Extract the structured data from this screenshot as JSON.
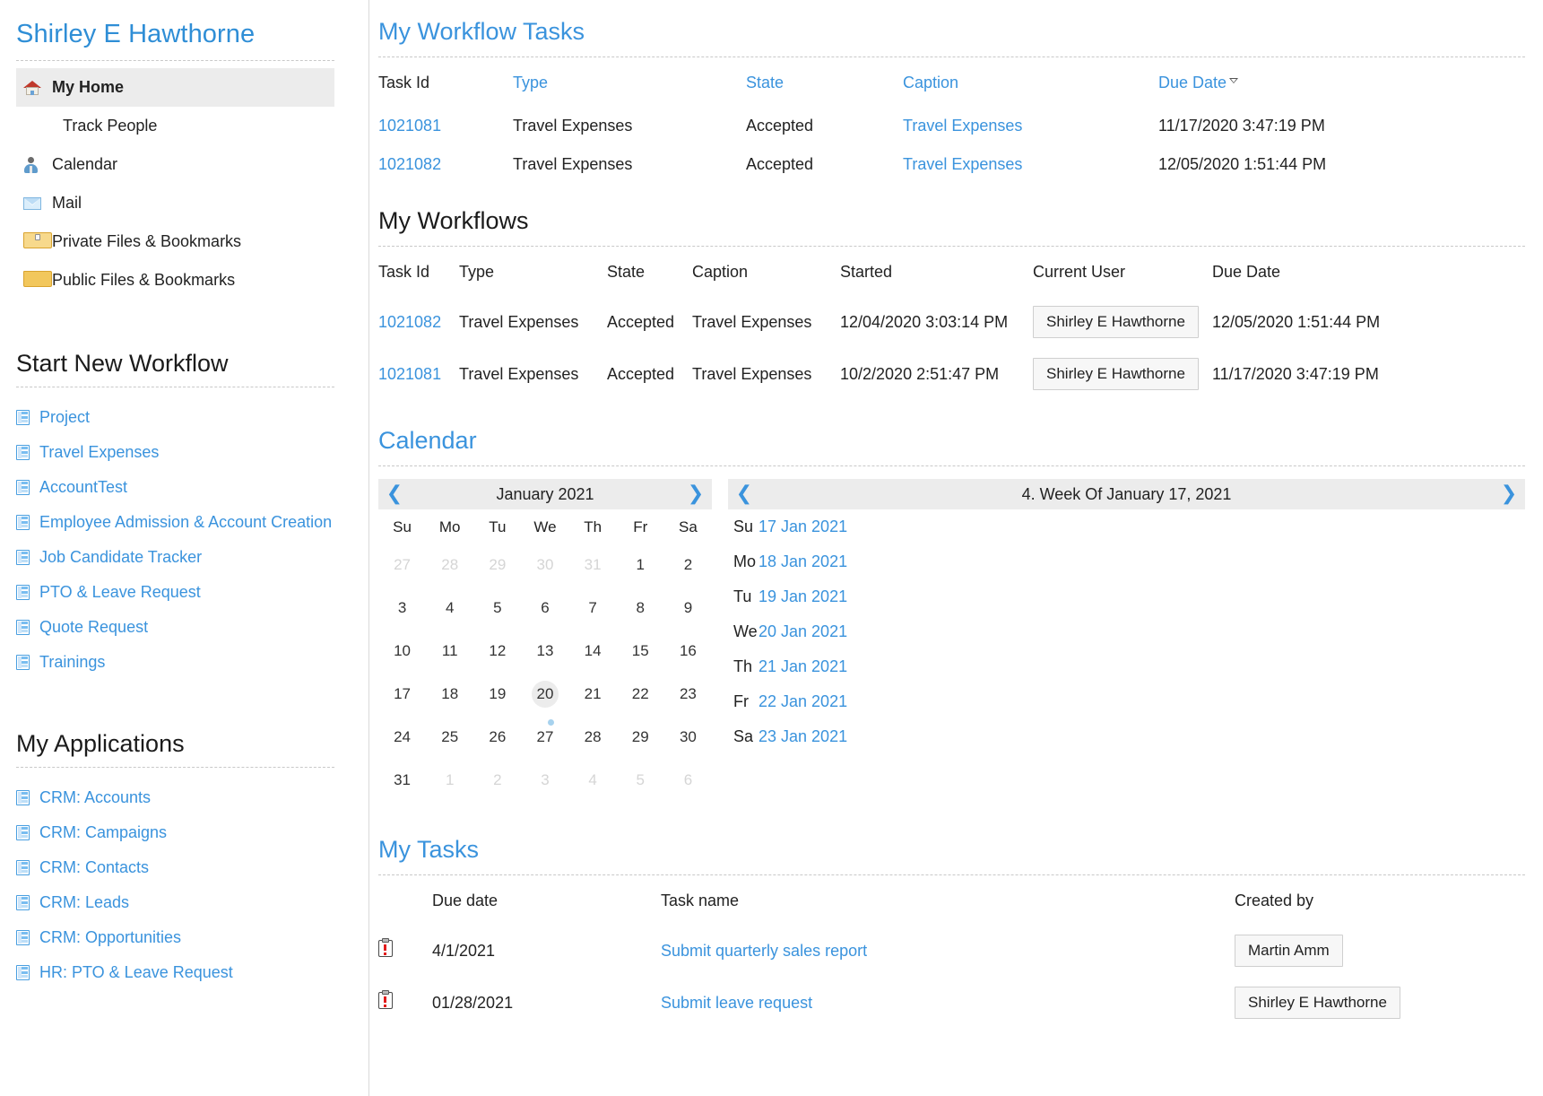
{
  "sidebar": {
    "user_name": "Shirley E Hawthorne",
    "nav": [
      {
        "label": "My Home",
        "icon": "home-icon",
        "active": true
      },
      {
        "label": "Track People",
        "icon": "none",
        "active": false
      },
      {
        "label": "Calendar",
        "icon": "person-icon",
        "active": false
      },
      {
        "label": "Mail",
        "icon": "mail-icon",
        "active": false
      },
      {
        "label": "Private Files & Bookmarks",
        "icon": "folder-lock-icon",
        "active": false
      },
      {
        "label": "Public Files & Bookmarks",
        "icon": "folder-icon",
        "active": false
      }
    ],
    "workflow_section_title": "Start New Workflow",
    "workflows": [
      "Project",
      "Travel Expenses",
      "AccountTest",
      "Employee Admission & Account Creation",
      "Job Candidate Tracker",
      "PTO & Leave Request",
      "Quote Request",
      "Trainings"
    ],
    "apps_section_title": "My Applications",
    "applications": [
      "CRM: Accounts",
      "CRM: Campaigns",
      "CRM: Contacts",
      "CRM: Leads",
      "CRM: Opportunities",
      "HR: PTO & Leave Request"
    ]
  },
  "workflow_tasks": {
    "title": "My Workflow Tasks",
    "columns": [
      "Task Id",
      "Type",
      "State",
      "Caption",
      "Due Date"
    ],
    "sorted_column": "Due Date",
    "rows": [
      {
        "task_id": "1021081",
        "type": "Travel Expenses",
        "state": "Accepted",
        "caption": "Travel Expenses",
        "due_date": "11/17/2020 3:47:19 PM"
      },
      {
        "task_id": "1021082",
        "type": "Travel Expenses",
        "state": "Accepted",
        "caption": "Travel Expenses",
        "due_date": "12/05/2020 1:51:44 PM"
      }
    ]
  },
  "workflows": {
    "title": "My Workflows",
    "columns": [
      "Task Id",
      "Type",
      "State",
      "Caption",
      "Started",
      "Current User",
      "Due Date"
    ],
    "rows": [
      {
        "task_id": "1021082",
        "type": "Travel Expenses",
        "state": "Accepted",
        "caption": "Travel Expenses",
        "started": "12/04/2020 3:03:14 PM",
        "current_user": "Shirley E Hawthorne",
        "due_date": "12/05/2020 1:51:44 PM"
      },
      {
        "task_id": "1021081",
        "type": "Travel Expenses",
        "state": "Accepted",
        "caption": "Travel Expenses",
        "started": "10/2/2020 2:51:47 PM",
        "current_user": "Shirley E Hawthorne",
        "due_date": "11/17/2020 3:47:19 PM"
      }
    ]
  },
  "calendar": {
    "title": "Calendar",
    "month_label": "January 2021",
    "prev_icon": "chevron-left-icon",
    "next_icon": "chevron-right-icon",
    "weekday_headers": [
      "Su",
      "Mo",
      "Tu",
      "We",
      "Th",
      "Fr",
      "Sa"
    ],
    "weeks": [
      [
        {
          "d": "27",
          "other": true
        },
        {
          "d": "28",
          "other": true
        },
        {
          "d": "29",
          "other": true
        },
        {
          "d": "30",
          "other": true
        },
        {
          "d": "31",
          "other": true
        },
        {
          "d": "1",
          "other": false
        },
        {
          "d": "2",
          "other": false
        }
      ],
      [
        {
          "d": "3"
        },
        {
          "d": "4"
        },
        {
          "d": "5"
        },
        {
          "d": "6"
        },
        {
          "d": "7"
        },
        {
          "d": "8"
        },
        {
          "d": "9"
        }
      ],
      [
        {
          "d": "10"
        },
        {
          "d": "11"
        },
        {
          "d": "12"
        },
        {
          "d": "13"
        },
        {
          "d": "14"
        },
        {
          "d": "15"
        },
        {
          "d": "16"
        }
      ],
      [
        {
          "d": "17"
        },
        {
          "d": "18"
        },
        {
          "d": "19"
        },
        {
          "d": "20",
          "today": true
        },
        {
          "d": "21"
        },
        {
          "d": "22"
        },
        {
          "d": "23"
        }
      ],
      [
        {
          "d": "24"
        },
        {
          "d": "25"
        },
        {
          "d": "26"
        },
        {
          "d": "27",
          "event": true
        },
        {
          "d": "28"
        },
        {
          "d": "29"
        },
        {
          "d": "30"
        }
      ],
      [
        {
          "d": "31"
        },
        {
          "d": "1",
          "other": true
        },
        {
          "d": "2",
          "other": true
        },
        {
          "d": "3",
          "other": true
        },
        {
          "d": "4",
          "other": true
        },
        {
          "d": "5",
          "other": true
        },
        {
          "d": "6",
          "other": true
        }
      ]
    ],
    "week_label": "4. Week Of January 17, 2021",
    "week_days": [
      {
        "dow": "Su",
        "date": "17 Jan 2021"
      },
      {
        "dow": "Mo",
        "date": "18 Jan 2021"
      },
      {
        "dow": "Tu",
        "date": "19 Jan 2021"
      },
      {
        "dow": "We",
        "date": "20 Jan 2021"
      },
      {
        "dow": "Th",
        "date": "21 Jan 2021"
      },
      {
        "dow": "Fr",
        "date": "22 Jan 2021"
      },
      {
        "dow": "Sa",
        "date": "23 Jan 2021"
      }
    ]
  },
  "my_tasks": {
    "title": "My Tasks",
    "columns": [
      "",
      "Due date",
      "Task name",
      "Created by"
    ],
    "rows": [
      {
        "icon": "task-priority-icon",
        "due_date": "4/1/2021",
        "task_name": "Submit quarterly sales report",
        "created_by": "Martin Amm"
      },
      {
        "icon": "task-priority-icon",
        "due_date": "01/28/2021",
        "task_name": "Submit leave request",
        "created_by": "Shirley E Hawthorne"
      }
    ]
  },
  "colors": {
    "link": "#3a93dd",
    "header_bg": "#ececec",
    "text": "#222222",
    "muted": "#d5d5d5"
  }
}
